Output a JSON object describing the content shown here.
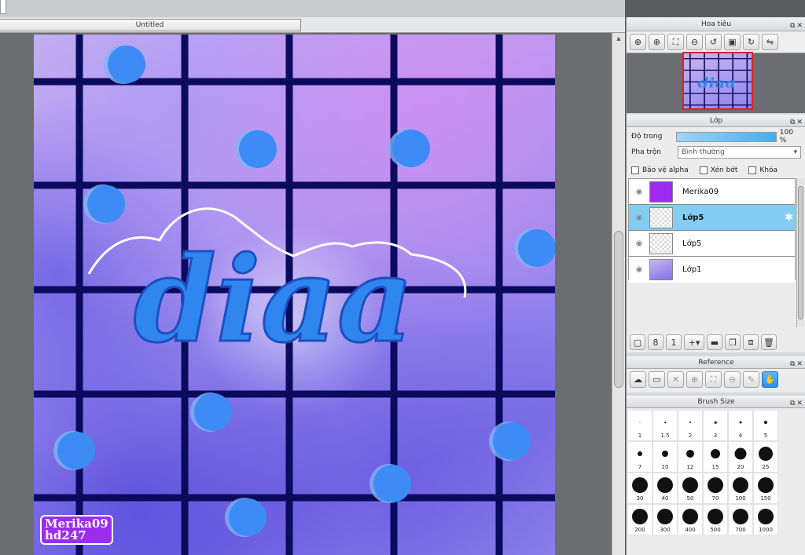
{
  "document": {
    "tab_title": "Untitled"
  },
  "canvas": {
    "lettering": "diaa",
    "watermark_lines": [
      "Merika09",
      "hd247"
    ],
    "colors": {
      "grid": "#0b0b5e",
      "dots": "#3d8cf5",
      "lettering": "#2f86ee"
    }
  },
  "navigator": {
    "title": "Hoa tiêu",
    "tools": [
      "zoom-fit-icon",
      "zoom-in-icon",
      "fit-window-icon",
      "zoom-out-icon",
      "rotate-left-icon",
      "fit-screen-icon",
      "rotate-right-icon",
      "flip-icon"
    ]
  },
  "layers_panel": {
    "title": "Lớp",
    "opacity_label": "Độ trong",
    "opacity_value": "100 %",
    "opacity_fraction": 1.0,
    "blend_label": "Pha trộn",
    "blend_value": "Bình thường",
    "protect_alpha_label": "Bảo vệ alpha",
    "clipping_label": "Xén bớt",
    "lock_label": "Khóa",
    "layers": [
      {
        "name": "Merika09",
        "selected": false
      },
      {
        "name": "Lớp5",
        "selected": true
      },
      {
        "name": "Lớp5",
        "selected": false
      },
      {
        "name": "Lớp1",
        "selected": false
      }
    ],
    "buttons": [
      "new-layer-icon",
      "new-8bit-layer-icon",
      "new-1bit-layer-icon",
      "add-layer-icon",
      "new-folder-icon",
      "duplicate-icon",
      "merge-down-icon",
      "delete-icon"
    ]
  },
  "reference_panel": {
    "title": "Reference",
    "tools": [
      "cloud-upload-icon",
      "open-folder-icon",
      "close-icon",
      "zoom-in-icon",
      "fit-icon",
      "zoom-out-icon",
      "eyedropper-icon",
      "hand-icon"
    ]
  },
  "brush_size_panel": {
    "title": "Brush Size",
    "sizes": [
      "1",
      "1.5",
      "2",
      "3",
      "4",
      "5",
      "7",
      "10",
      "12",
      "15",
      "20",
      "25",
      "30",
      "40",
      "50",
      "70",
      "100",
      "150",
      "200",
      "300",
      "400",
      "500",
      "700",
      "1000"
    ]
  }
}
